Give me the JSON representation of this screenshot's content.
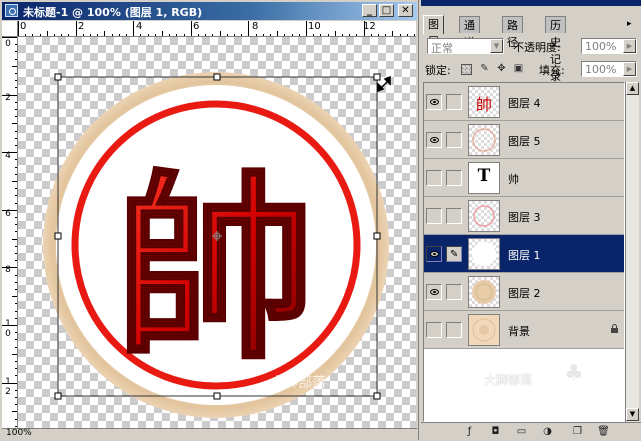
{
  "document": {
    "title": "未标题-1 @ 100% (图层 1, RGB)",
    "window_buttons": {
      "minimize": "_",
      "maximize": "□",
      "close": "✕"
    },
    "ruler_h_labels": [
      "0",
      "2",
      "4",
      "6",
      "8",
      "10",
      "12"
    ],
    "ruler_v_labels": [
      "0",
      "2",
      "4",
      "6",
      "8",
      "1\n0",
      "1\n2"
    ],
    "canvas_glyph": "帥",
    "watermark": "大脚部落",
    "zoom": "100%",
    "colors": {
      "ring": "#e6cba8",
      "red": "#e21010",
      "dark_red": "#7a0000"
    }
  },
  "layers_panel": {
    "tabs": [
      {
        "label": "图层",
        "active": true
      },
      {
        "label": "通道",
        "active": false
      },
      {
        "label": "路径",
        "active": false
      },
      {
        "label": "历史记录",
        "active": false
      }
    ],
    "menu_arrow": "▸",
    "blend_mode": "正常",
    "opacity_label": "不透明度:",
    "opacity_value": "100%",
    "lock_label": "锁定:",
    "fill_label": "填充:",
    "fill_value": "100%",
    "layers": [
      {
        "name": "图层 4",
        "visible": true,
        "thumb": "char",
        "thumb_text": "帥",
        "selected": false
      },
      {
        "name": "图层 5",
        "visible": true,
        "thumb": "transparent",
        "selected": false
      },
      {
        "name": "帅",
        "visible": false,
        "thumb": "text",
        "thumb_text": "T",
        "selected": false
      },
      {
        "name": "图层 3",
        "visible": false,
        "thumb": "transparent",
        "selected": false
      },
      {
        "name": "图层 1",
        "visible": true,
        "thumb": "plain",
        "selected": true
      },
      {
        "name": "图层 2",
        "visible": true,
        "thumb": "transparent",
        "selected": false
      },
      {
        "name": "背景",
        "visible": false,
        "thumb": "background",
        "selected": false,
        "locked": true
      }
    ],
    "watermark": "大脚部落",
    "selected_color": "#0a246a"
  }
}
